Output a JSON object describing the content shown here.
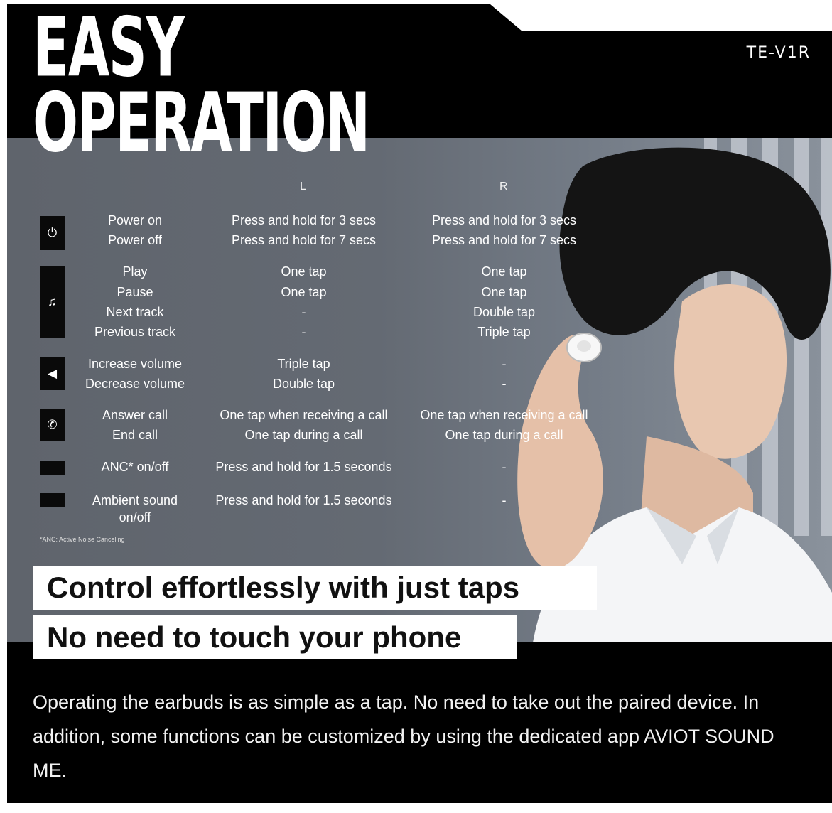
{
  "title": {
    "line1": "EASY",
    "line2": "OPERATION"
  },
  "model": "TE-V1R",
  "table": {
    "col_l": "L",
    "col_r": "R",
    "groups": [
      {
        "icon": "power-icon",
        "glyph": "⏻",
        "rows": [
          {
            "label": "Power on",
            "l": "Press and hold for 3 secs",
            "r": "Press and hold for 3 secs"
          },
          {
            "label": "Power off",
            "l": "Press and hold for 7 secs",
            "r": "Press and hold for 7 secs"
          }
        ]
      },
      {
        "icon": "music-note-icon",
        "glyph": "♫",
        "rows": [
          {
            "label": "Play",
            "l": "One tap",
            "r": "One tap"
          },
          {
            "label": "Pause",
            "l": "One tap",
            "r": "One tap"
          },
          {
            "label": "Next track",
            "l": "-",
            "r": "Double tap"
          },
          {
            "label": "Previous track",
            "l": "-",
            "r": "Triple tap"
          }
        ]
      },
      {
        "icon": "speaker-icon",
        "glyph": "◀",
        "rows": [
          {
            "label": "Increase volume",
            "l": "Triple tap",
            "r": "-"
          },
          {
            "label": "Decrease volume",
            "l": "Double tap",
            "r": "-"
          }
        ]
      },
      {
        "icon": "phone-icon",
        "glyph": "✆",
        "rows": [
          {
            "label": "Answer call",
            "l": "One tap when receiving a call",
            "r": "One tap when receiving a call"
          },
          {
            "label": "End call",
            "l": "One tap during a call",
            "r": "One tap during a call"
          }
        ]
      },
      {
        "icon": "anc-icon",
        "glyph": "",
        "rows": [
          {
            "label": "ANC* on/off",
            "l": "Press and hold for 1.5 seconds",
            "r": "-"
          }
        ]
      },
      {
        "icon": "ambient-icon",
        "glyph": "",
        "rows": [
          {
            "label": "Ambient sound",
            "label2": "on/off",
            "l": "Press and hold for 1.5 seconds",
            "r": "-"
          }
        ]
      }
    ],
    "footnote": "*ANC: Active Noise Canceling"
  },
  "headline1": "Control effortlessly with just taps",
  "headline2": "No need to touch your phone",
  "description": "Operating the earbuds is as simple as a tap. No need to take out the paired device. In addition, some functions can be customized by using the dedicated app AVIOT SOUND ME."
}
